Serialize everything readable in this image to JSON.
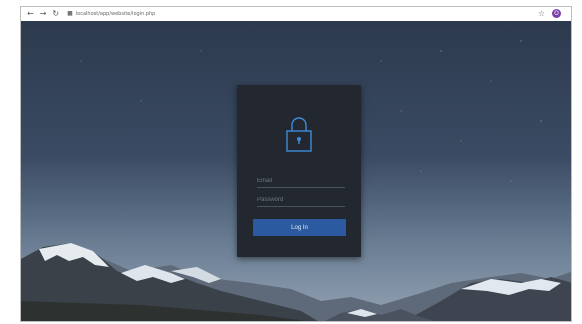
{
  "browser": {
    "url": "localhost/app/website/login.php",
    "nav_back_icon": "back-arrow-icon",
    "nav_forward_icon": "forward-arrow-icon",
    "nav_reload_icon": "reload-icon",
    "bookmark_icon": "star-icon",
    "profile_initial": "O"
  },
  "login": {
    "icon": "padlock-icon",
    "email_placeholder": "Email",
    "password_placeholder": "Password",
    "submit_label": "Log In"
  },
  "colors": {
    "card_bg": "#232830",
    "accent": "#2c5aa0",
    "lock_icon": "#3d8bd9",
    "profile": "#7b3fa8"
  }
}
